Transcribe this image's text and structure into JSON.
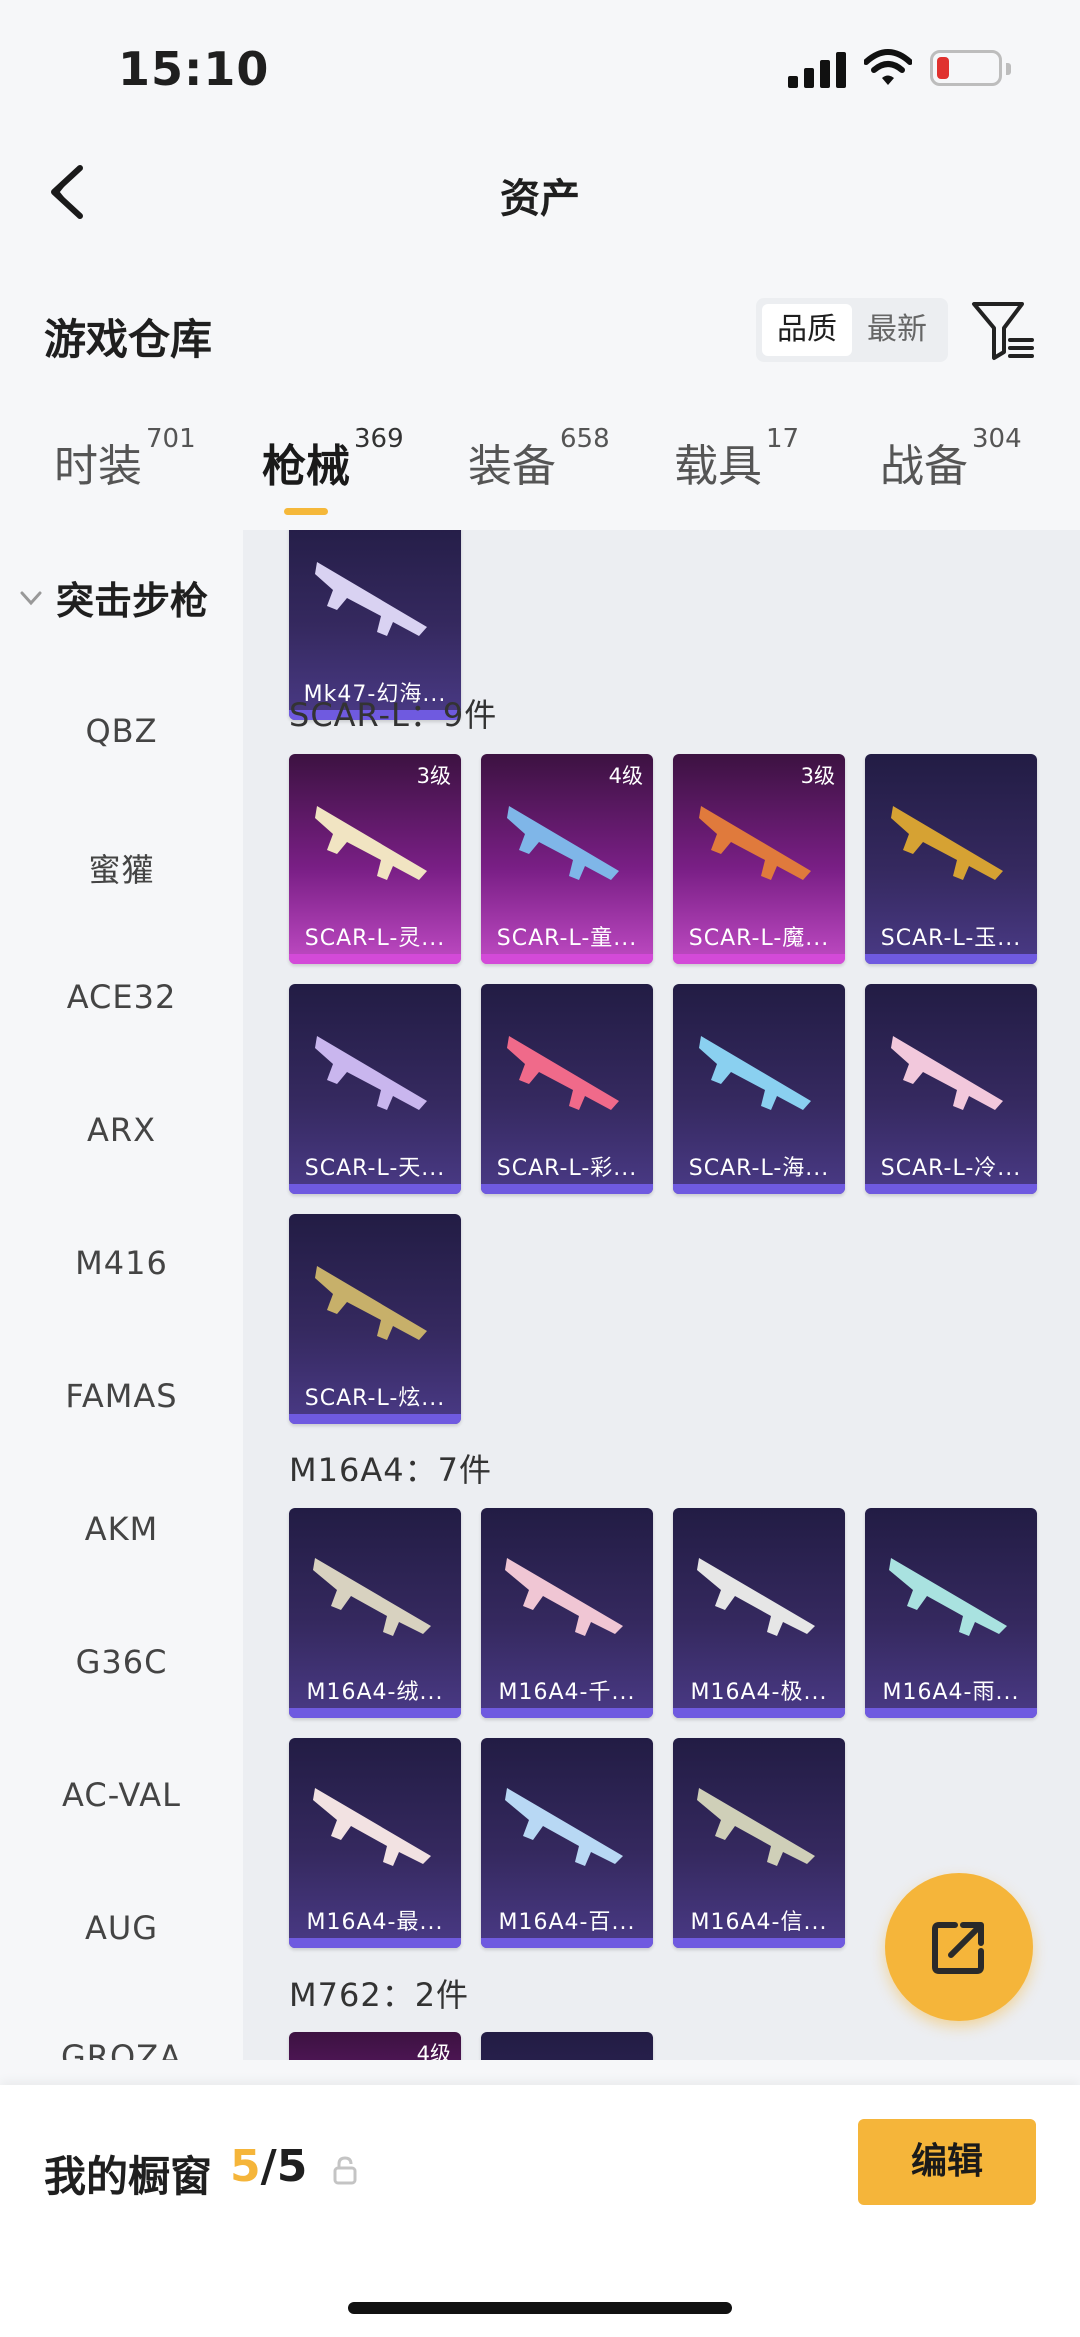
{
  "status_bar": {
    "time": "15:10"
  },
  "nav": {
    "title": "资产"
  },
  "warehouse": {
    "title": "游戏仓库",
    "sort_quality": "品质",
    "sort_latest": "最新"
  },
  "tabs": [
    {
      "label": "时装",
      "count": "701"
    },
    {
      "label": "枪械",
      "count": "369"
    },
    {
      "label": "装备",
      "count": "658"
    },
    {
      "label": "载具",
      "count": "17"
    },
    {
      "label": "战备",
      "count": "304"
    }
  ],
  "sidebar": {
    "group": "突击步枪",
    "items": [
      "QBZ",
      "蜜獾",
      "ACE32",
      "ARX",
      "M416",
      "FAMAS",
      "AKM",
      "G36C",
      "AC-VAL",
      "AUG",
      "GROZA"
    ]
  },
  "content": {
    "top_item": {
      "name": "Mk47-幻海..."
    },
    "sections": [
      {
        "label": "SCAR-L：9件",
        "items": [
          {
            "name": "SCAR-L-灵...",
            "level": "3级"
          },
          {
            "name": "SCAR-L-童...",
            "level": "4级"
          },
          {
            "name": "SCAR-L-魔...",
            "level": "3级"
          },
          {
            "name": "SCAR-L-玉...",
            "level": ""
          },
          {
            "name": "SCAR-L-天...",
            "level": ""
          },
          {
            "name": "SCAR-L-彩...",
            "level": ""
          },
          {
            "name": "SCAR-L-海...",
            "level": ""
          },
          {
            "name": "SCAR-L-冷...",
            "level": ""
          },
          {
            "name": "SCAR-L-炫...",
            "level": ""
          }
        ]
      },
      {
        "label": "M16A4：7件",
        "items": [
          {
            "name": "M16A4-绒..."
          },
          {
            "name": "M16A4-千..."
          },
          {
            "name": "M16A4-极..."
          },
          {
            "name": "M16A4-雨..."
          },
          {
            "name": "M16A4-最..."
          },
          {
            "name": "M16A4-百..."
          },
          {
            "name": "M16A4-信..."
          }
        ]
      },
      {
        "label": "M762：2件",
        "items": [
          {
            "level": "4级"
          }
        ]
      }
    ]
  },
  "showcase": {
    "label": "我的橱窗",
    "current": "5",
    "total": "/5",
    "edit_label": "编辑"
  },
  "colors": {
    "accent": "#f5b53a",
    "card_purple": "#4a3a86",
    "card_pink": "#c04bc4"
  }
}
